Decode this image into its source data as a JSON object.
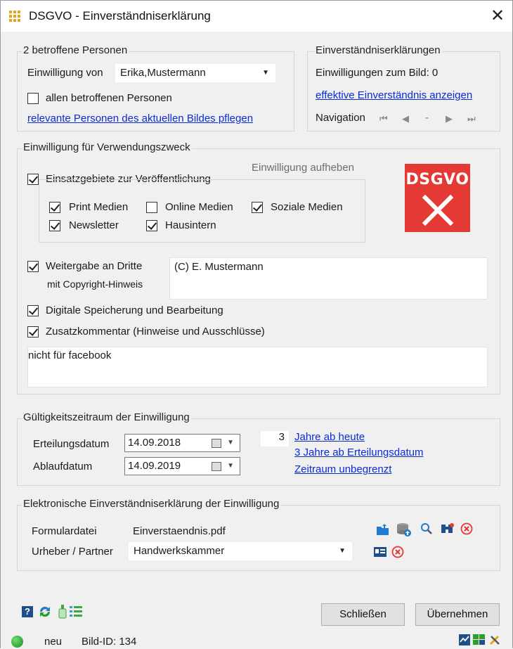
{
  "window": {
    "title": "DSGVO - Einverständniserklärung",
    "close_symbol": "✕"
  },
  "persons": {
    "legend": "2 betroffene Personen",
    "consent_from_label": "Einwilligung von",
    "consent_from_value": "Erika,Mustermann",
    "all_persons_label": "allen betroffenen Personen",
    "all_persons_checked": false,
    "maintain_link": "relevante Personen des aktuellen Bildes pflegen"
  },
  "declarations": {
    "legend": "Einverständniserklärungen",
    "count_text": "Einwilligungen zum Bild: 0",
    "effective_link": "effektive Einverständnis anzeigen",
    "navigation_label": "Navigation",
    "nav_position": "-"
  },
  "purpose": {
    "legend": "Einwilligung für Verwendungszweck",
    "revoke_label": "Einwilligung aufheben",
    "badge_text": "DSGVO",
    "areas_label": "Einsatzgebiete zur Veröffentlichung",
    "areas_checked": true,
    "options": {
      "print": {
        "label": "Print Medien",
        "checked": true
      },
      "online": {
        "label": "Online Medien",
        "checked": false
      },
      "social": {
        "label": "Soziale Medien",
        "checked": true
      },
      "newsletter": {
        "label": "Newsletter",
        "checked": true
      },
      "internal": {
        "label": "Hausintern",
        "checked": true
      }
    },
    "third_party_label": "Weitergabe an Dritte",
    "third_party_sub": "mit Copyright-Hinweis",
    "third_party_checked": true,
    "copyright_value": "(C) E. Mustermann",
    "digital_label": "Digitale Speicherung und Bearbeitung",
    "digital_checked": true,
    "comment_label": "Zusatzkommentar (Hinweise und Ausschlüsse)",
    "comment_checked": true,
    "comment_value": "nicht für facebook"
  },
  "validity": {
    "legend": "Gültigkeitszeitraum der Einwilligung",
    "issue_label": "Erteilungsdatum",
    "issue_date": "14.09.2018",
    "expiry_label": "Ablaufdatum",
    "expiry_date": "14.09.2019",
    "years_value": "3",
    "link_years_from_today": "Jahre ab heute",
    "link_years_from_issue": "3 Jahre ab Erteilungsdatum",
    "link_unlimited": "Zeitraum unbegrenzt"
  },
  "electronic": {
    "legend": "Elektronische Einverständniserklärung der Einwilligung",
    "form_file_label": "Formulardatei",
    "form_file_value": "Einverstaendnis.pdf",
    "author_label": "Urheber / Partner",
    "author_value": "Handwerkskammer"
  },
  "buttons": {
    "close": "Schließen",
    "apply": "Übernehmen"
  },
  "status": {
    "state": "neu",
    "image_id": "Bild-ID: 134"
  },
  "colors": {
    "link": "#0b2bd8",
    "badge": "#e53935",
    "accent": "#e8a317"
  }
}
